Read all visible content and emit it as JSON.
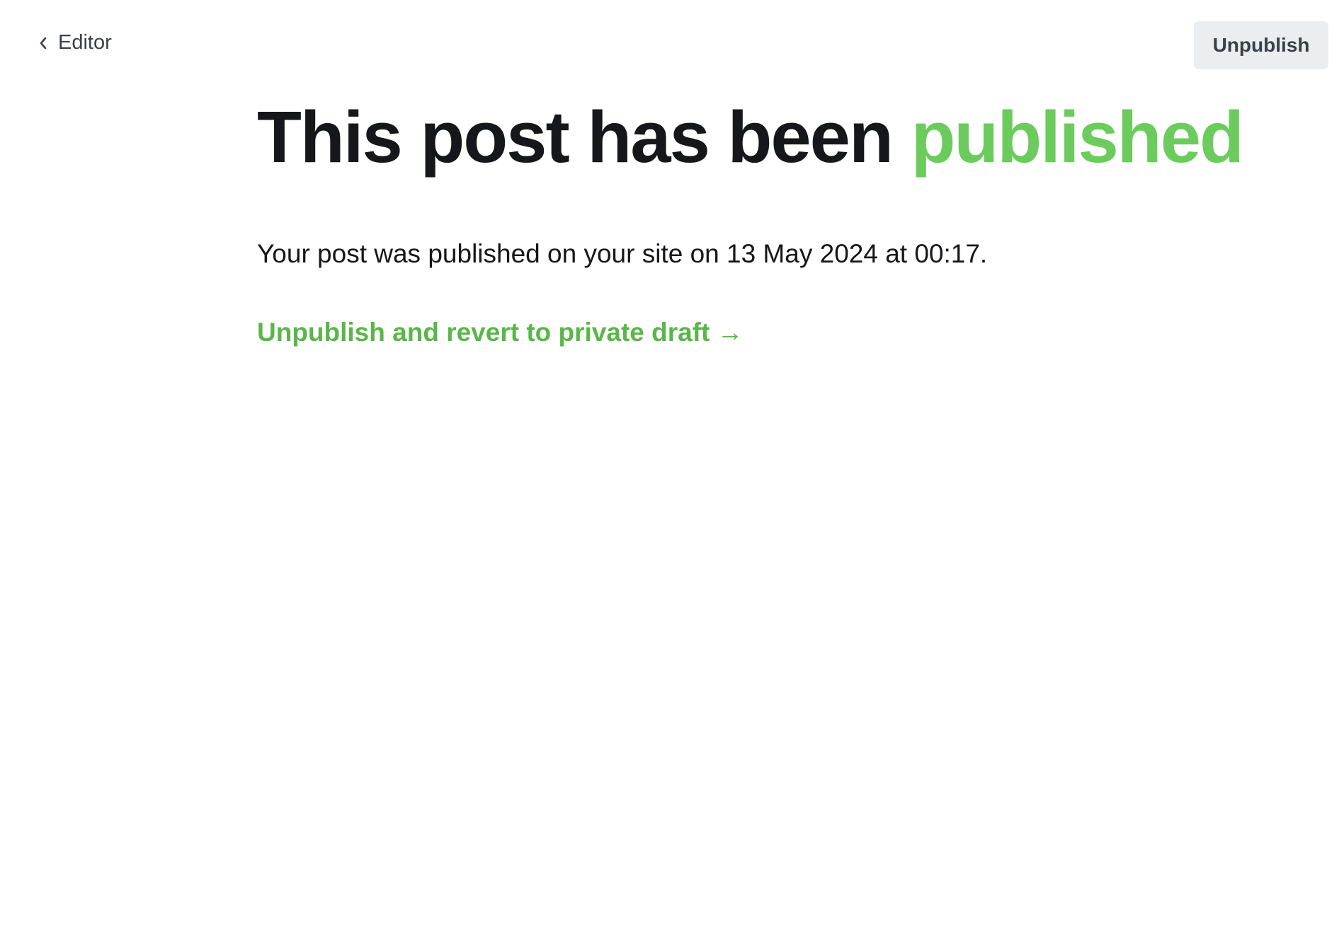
{
  "header": {
    "back_label": "Editor",
    "unpublish_label": "Unpublish"
  },
  "main": {
    "headline_prefix": "This post has been",
    "headline_status": "published",
    "published_message": "Your post was published on your site on 13 May 2024 at 00:17.",
    "revert_link_label": "Unpublish and revert to private draft →"
  },
  "colors": {
    "accent": "#6bcb5c",
    "link": "#5ab64a",
    "text": "#15171a",
    "button_bg": "#ebeef0"
  }
}
